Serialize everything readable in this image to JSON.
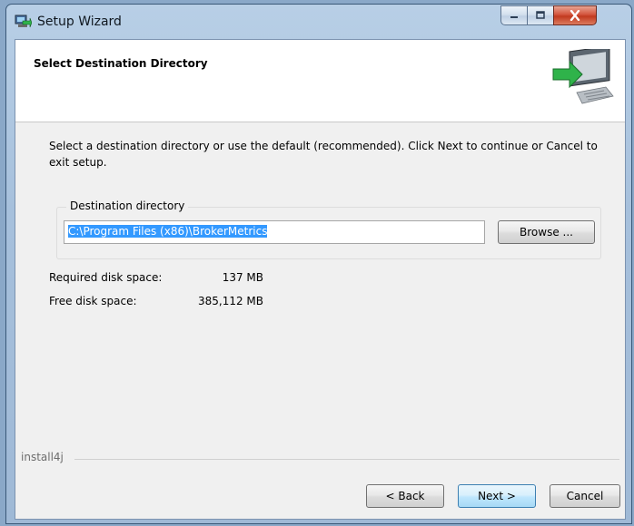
{
  "window": {
    "title": "Setup Wizard"
  },
  "header": {
    "title": "Select Destination Directory"
  },
  "intro": {
    "text": "Select a destination directory or use the default  (recommended).  Click Next to continue or Cancel to exit setup."
  },
  "destination": {
    "legend": "Destination directory",
    "path": "C:\\Program Files (x86)\\BrokerMetrics",
    "browse_label": "Browse ..."
  },
  "disk": {
    "required_label": "Required disk space:",
    "required_value": "137 MB",
    "free_label": "Free disk space:",
    "free_value": "385,112 MB"
  },
  "footer": {
    "brand": "install4j",
    "back_label": "< Back",
    "next_label": "Next >",
    "cancel_label": "Cancel"
  },
  "colors": {
    "selection": "#3399ff",
    "install_arrow": "#2fb34a",
    "close_button": "#c9452b"
  },
  "icons": [
    "setup-app-icon",
    "minimize-icon",
    "maximize-icon",
    "close-icon",
    "install-computer-graphic"
  ]
}
